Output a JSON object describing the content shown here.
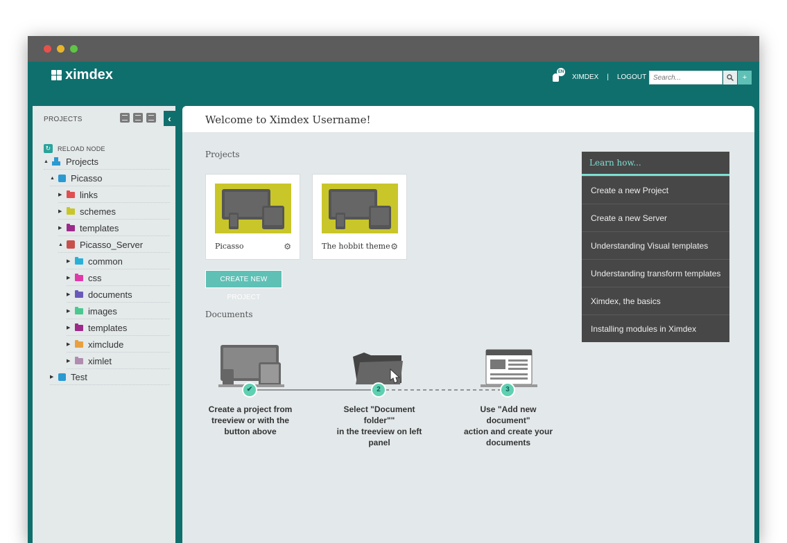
{
  "app": {
    "logo_text": "ximdex"
  },
  "header": {
    "user_badge": "EN",
    "username": "XIMDEX",
    "separator": "|",
    "logout": "LOGOUT",
    "search_placeholder": "Search...",
    "add_label": "+"
  },
  "sidebar": {
    "title": "PROJECTS",
    "collapse_label": "‹",
    "reload_label": "RELOAD NODE",
    "tree": [
      {
        "label": "Projects",
        "color": "#2a9ad1"
      },
      {
        "label": "Picasso",
        "color": "#2a9ad1"
      },
      {
        "label": "links",
        "color": "#e05050"
      },
      {
        "label": "schemes",
        "color": "#c9c62a"
      },
      {
        "label": "templates",
        "color": "#9c2a8a"
      },
      {
        "label": "Picasso_Server",
        "color": "#c8504a"
      },
      {
        "label": "common",
        "color": "#2ab0d8"
      },
      {
        "label": "css",
        "color": "#e03aa8"
      },
      {
        "label": "documents",
        "color": "#6a5ab8"
      },
      {
        "label": "images",
        "color": "#4ac890"
      },
      {
        "label": "templates",
        "color": "#9c2a8a"
      },
      {
        "label": "ximclude",
        "color": "#e8a040"
      },
      {
        "label": "ximlet",
        "color": "#b08cb0"
      },
      {
        "label": "Test",
        "color": "#2a9ad1"
      }
    ]
  },
  "main": {
    "title": "Welcome to Ximdex Username!",
    "projects_title": "Projects",
    "projects": [
      {
        "name": "Picasso"
      },
      {
        "name": "The hobbit theme"
      }
    ],
    "create_button": "CREATE NEW PROJECT",
    "documents_title": "Documents",
    "steps": [
      {
        "num": "✔",
        "text_lines": [
          "Create a project from",
          "treeview or with the",
          "button above"
        ]
      },
      {
        "num": "2",
        "text_lines": [
          "Select \"Document folder\"\"",
          "in the treeview on left",
          "panel"
        ]
      },
      {
        "num": "3",
        "text_lines": [
          "Use \"Add new document\"",
          "action and create your",
          "documents"
        ]
      }
    ]
  },
  "learn": {
    "title": "Learn how...",
    "items": [
      "Create a new Project",
      "Create a new Server",
      "Understanding Visual templates",
      "Understanding transform templates",
      "Ximdex, the basics",
      "Installing modules in Ximdex"
    ]
  },
  "colors": {
    "brand": "#0f6f6d",
    "accent": "#5fc0b6",
    "thumb": "#c9c62a"
  }
}
